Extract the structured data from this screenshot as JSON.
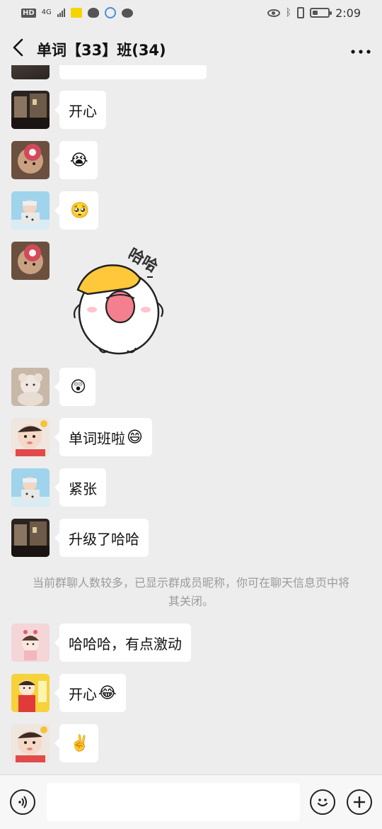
{
  "status_bar": {
    "hd": "HD",
    "network": "4G",
    "time": "2:09",
    "battery_level": 0.35
  },
  "header": {
    "title": "单词【33】班(34)",
    "back_icon": "chevron-left-icon",
    "more_icon": "more-dots-icon"
  },
  "messages": [
    {
      "type": "text",
      "text": "开心",
      "avatar": "avatar-street"
    },
    {
      "type": "emoji",
      "emoji": "😭",
      "avatar": "avatar-flower"
    },
    {
      "type": "emoji",
      "emoji": "🥺",
      "avatar": "avatar-baby-blue"
    },
    {
      "type": "sticker",
      "sticker_text": "哈哈",
      "avatar": "avatar-flower"
    },
    {
      "type": "emoji",
      "emoji": "😲",
      "avatar": "avatar-teddy"
    },
    {
      "type": "text",
      "text": "单词班啦",
      "emoji": "😄",
      "avatar": "avatar-baby-face"
    },
    {
      "type": "text",
      "text": "紧张",
      "avatar": "avatar-baby-blue"
    },
    {
      "type": "text",
      "text": "升级了哈哈",
      "avatar": "avatar-street"
    },
    {
      "type": "notice",
      "text": "当前群聊人数较多，已显示群成员昵称，你可在聊天信息页中将其关闭。"
    },
    {
      "type": "text",
      "text": "哈哈哈，有点激动",
      "avatar": "avatar-cartoon-girl"
    },
    {
      "type": "text",
      "text": "开心",
      "emoji": "😂",
      "avatar": "avatar-cartoon-jiayou"
    },
    {
      "type": "emoji",
      "emoji": "✌️",
      "avatar": "avatar-baby-face"
    }
  ],
  "input_bar": {
    "voice_icon": "voice-icon",
    "emoji_icon": "smiley-icon",
    "plus_icon": "plus-icon",
    "text_value": ""
  },
  "colors": {
    "background": "#ededed",
    "bubble": "#ffffff",
    "notice_text": "#9b9b9b"
  }
}
